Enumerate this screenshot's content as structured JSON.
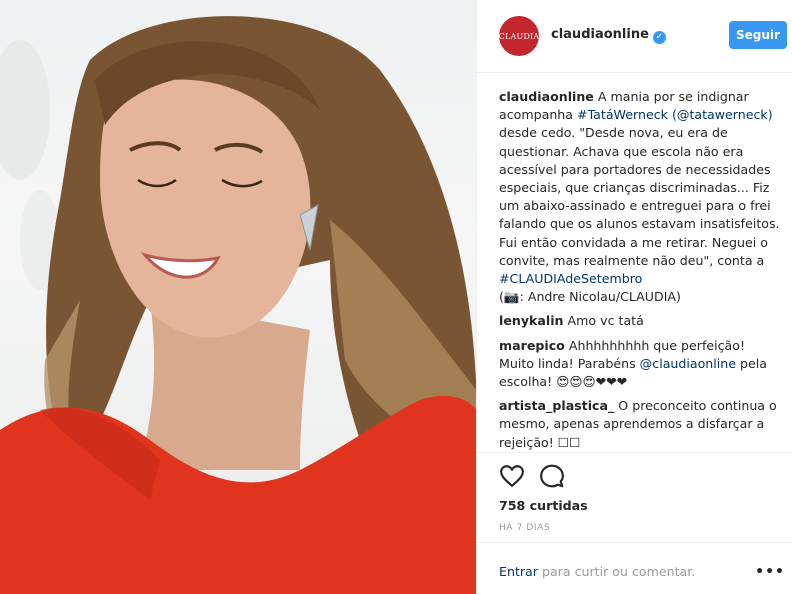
{
  "post": {
    "account": {
      "avatar_text": "CLAUDIA",
      "username": "claudiaonline",
      "verified_mark": "✓",
      "follow_label": "Seguir"
    },
    "caption": {
      "username": "claudiaonline",
      "t1": "A mania por se indignar acompanha ",
      "tag1": "#TatáWerneck",
      "t2": " ",
      "mention1": "(@tatawerneck)",
      "t3": " desde cedo. \"Desde nova, eu era de questionar. Achava que escola não era acessível para portadores de necessidades especiais, que crianças discriminadas... Fiz um abaixo-assinado e entreguei para o frei falando que os alunos estavam insatisfeitos. Fui então convidada a me retirar. Neguei o convite, mas realmente não deu\", conta a ",
      "tag2": "#CLAUDIAdeSetembro",
      "t4": "(📷: Andre Nicolau/CLAUDIA)"
    },
    "comments": [
      {
        "username": "lenykalin",
        "pre": "Amo vc tatá"
      },
      {
        "username": "marepico",
        "pre": "Ahhhhhhhhh que perfeição! Muito linda! Parabéns ",
        "mention": "@claudiaonline",
        "post": " pela escolha! 😍😍😍❤❤❤"
      },
      {
        "username": "artista_plastica_",
        "pre": "O preconceito continua o mesmo, apenas aprendemos a disfarçar a rejeição! ☐☐"
      }
    ],
    "likes": "758 curtidas",
    "time": "HÁ 7 DIAS",
    "add_comment": {
      "enter": "Entrar",
      "rest": " para curtir ou comentar."
    },
    "more_label": "•••",
    "icons": {
      "like": "heart-icon",
      "comment": "comment-bubble-icon",
      "more": "more-options-icon"
    },
    "colors": {
      "follow": "#3897f0",
      "link": "#003569",
      "avatar": "#c4262e",
      "dress": "#e0341e"
    }
  }
}
